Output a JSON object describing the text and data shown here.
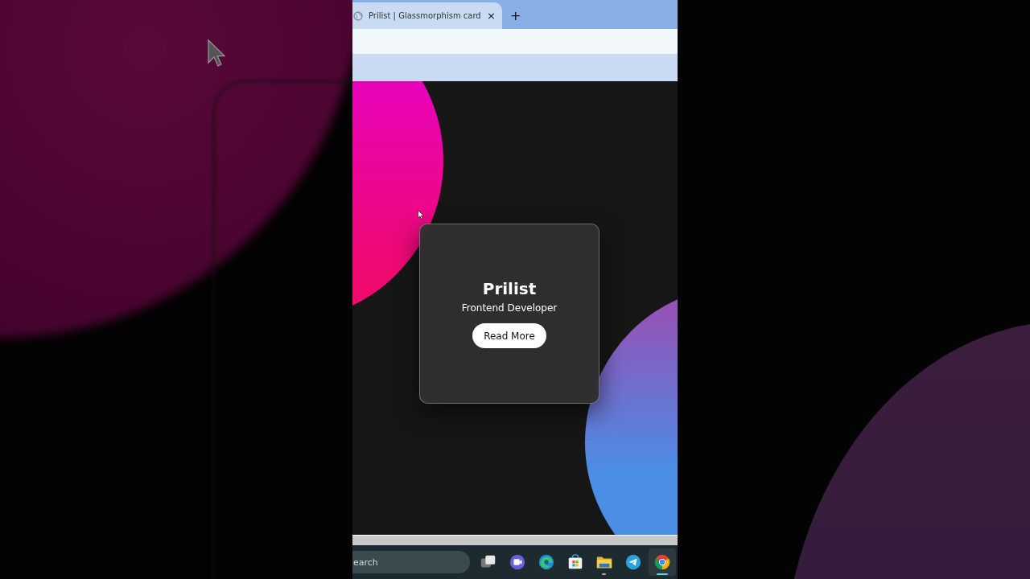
{
  "browser": {
    "tabs": [
      {
        "title": "Prilist | Glassmorphism card",
        "close": "×",
        "selected": true
      }
    ],
    "new_tab": "+"
  },
  "card": {
    "title": "Prilist",
    "subtitle": "Frontend Developer",
    "button": "Read More"
  },
  "taskbar": {
    "search": {
      "placeholder": "earch"
    },
    "apps": [
      {
        "kind": "task-view",
        "running": false,
        "active": false
      },
      {
        "kind": "video",
        "running": false,
        "active": false
      },
      {
        "kind": "edge",
        "running": false,
        "active": false
      },
      {
        "kind": "store",
        "running": false,
        "active": false
      },
      {
        "kind": "folder",
        "running": true,
        "active": false
      },
      {
        "kind": "send",
        "running": false,
        "active": false
      },
      {
        "kind": "chrome",
        "running": true,
        "active": true
      }
    ]
  }
}
